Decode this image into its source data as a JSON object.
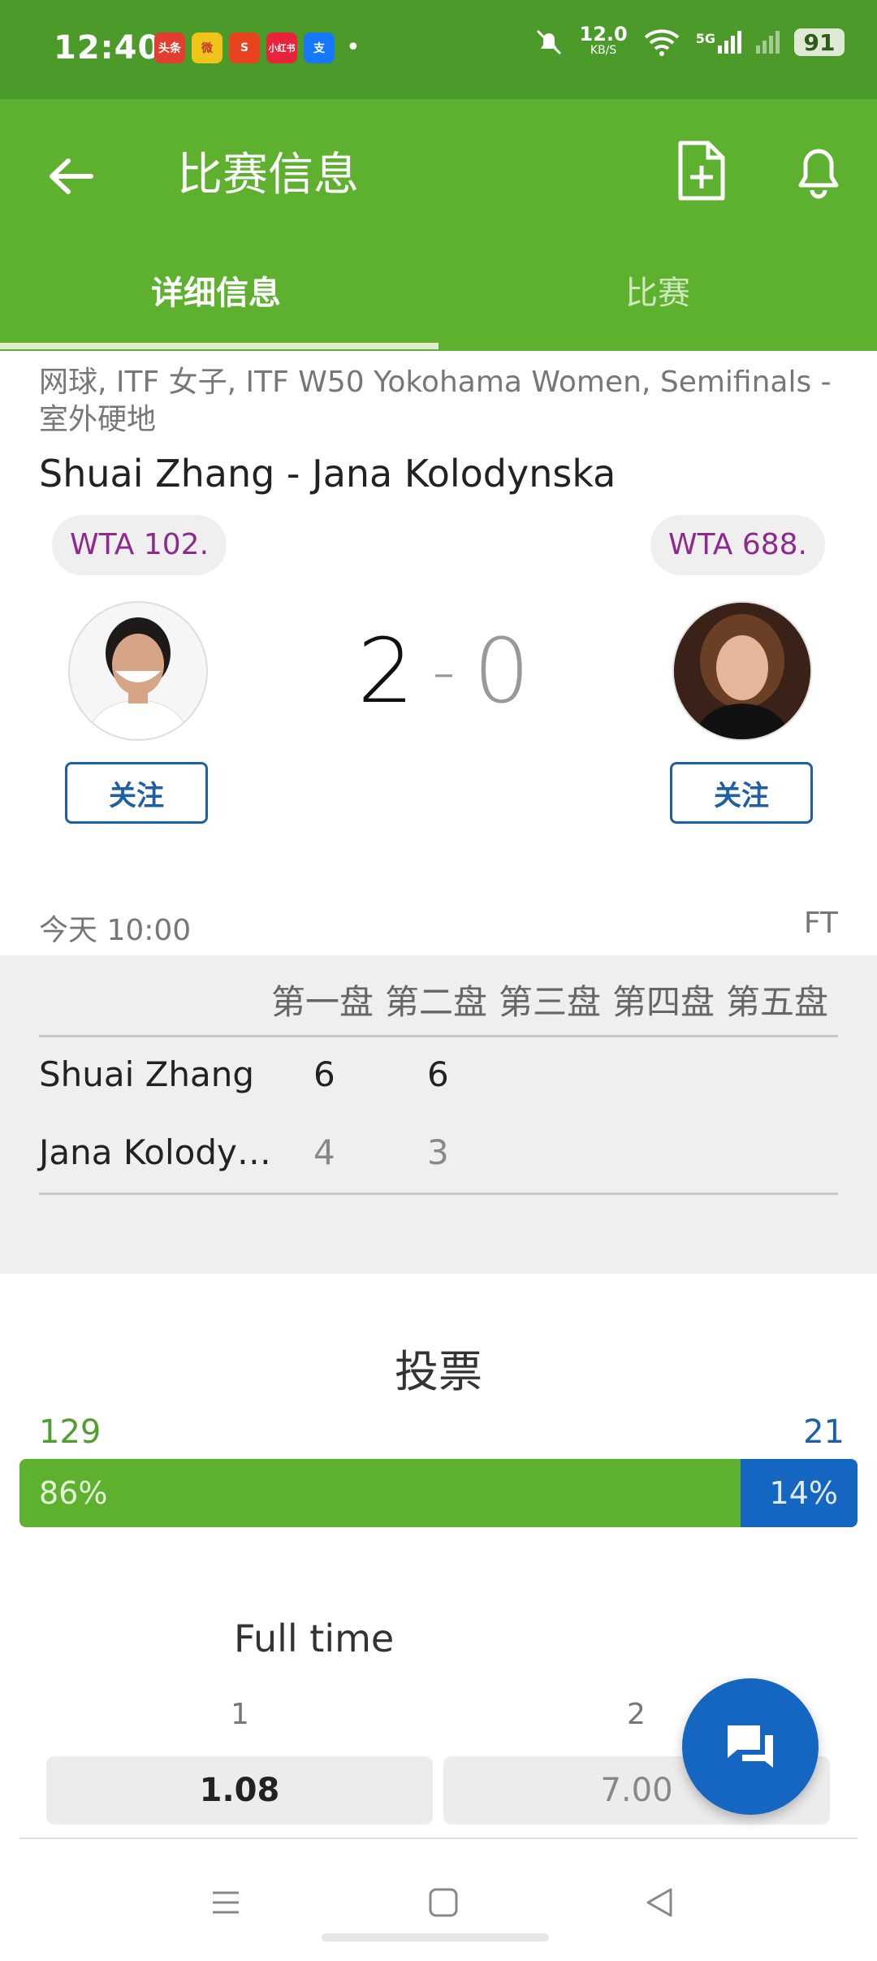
{
  "status_bar": {
    "time": "12:40",
    "notif_apps": [
      {
        "label": "头条",
        "color": "#e23d2e"
      },
      {
        "label": "微",
        "color": "#f0c419"
      },
      {
        "label": "S",
        "color": "#e8431f"
      },
      {
        "label": "小红书",
        "color": "#e7243a"
      },
      {
        "label": "支",
        "color": "#1677ff"
      }
    ],
    "dot": "•",
    "speed_value": "12.0",
    "speed_unit": "KB/S",
    "network": "5G",
    "battery": "91"
  },
  "app_bar": {
    "title": "比赛信息",
    "tabs": [
      {
        "label": "详细信息",
        "active": true
      },
      {
        "label": "比赛",
        "active": false
      }
    ]
  },
  "match": {
    "breadcrumb": "网球, ITF 女子, ITF W50 Yokohama Women, Semifinals - 室外硬地",
    "name": "Shuai Zhang - Jana Kolodynska",
    "player1": {
      "rank": "WTA 102.",
      "follow": "关注"
    },
    "player2": {
      "rank": "WTA 688.",
      "follow": "关注"
    },
    "score_home": "2",
    "score_sep": "-",
    "score_away": "0",
    "time": "今天 10:00",
    "status": "FT"
  },
  "sets_table": {
    "headers": [
      "第一盘",
      "第二盘",
      "第三盘",
      "第四盘",
      "第五盘"
    ],
    "rows": [
      {
        "name": "Shuai Zhang",
        "scores": [
          "6",
          "6"
        ]
      },
      {
        "name": "Jana Kolody…",
        "scores": [
          "4",
          "3"
        ]
      }
    ]
  },
  "vote": {
    "title": "投票",
    "left_count": "129",
    "right_count": "21",
    "left_pct": "86%",
    "right_pct": "14%",
    "left_fraction": 0.86,
    "colors": {
      "left": "#5db12f",
      "right": "#1566c0"
    }
  },
  "odds": {
    "title": "Full time",
    "labels": [
      "1",
      "2"
    ],
    "values": [
      "1.08",
      "7.00"
    ]
  },
  "colors": {
    "accent_green": "#5db12f",
    "status_green": "#4c9a2a",
    "accent_blue": "#1566c0"
  }
}
